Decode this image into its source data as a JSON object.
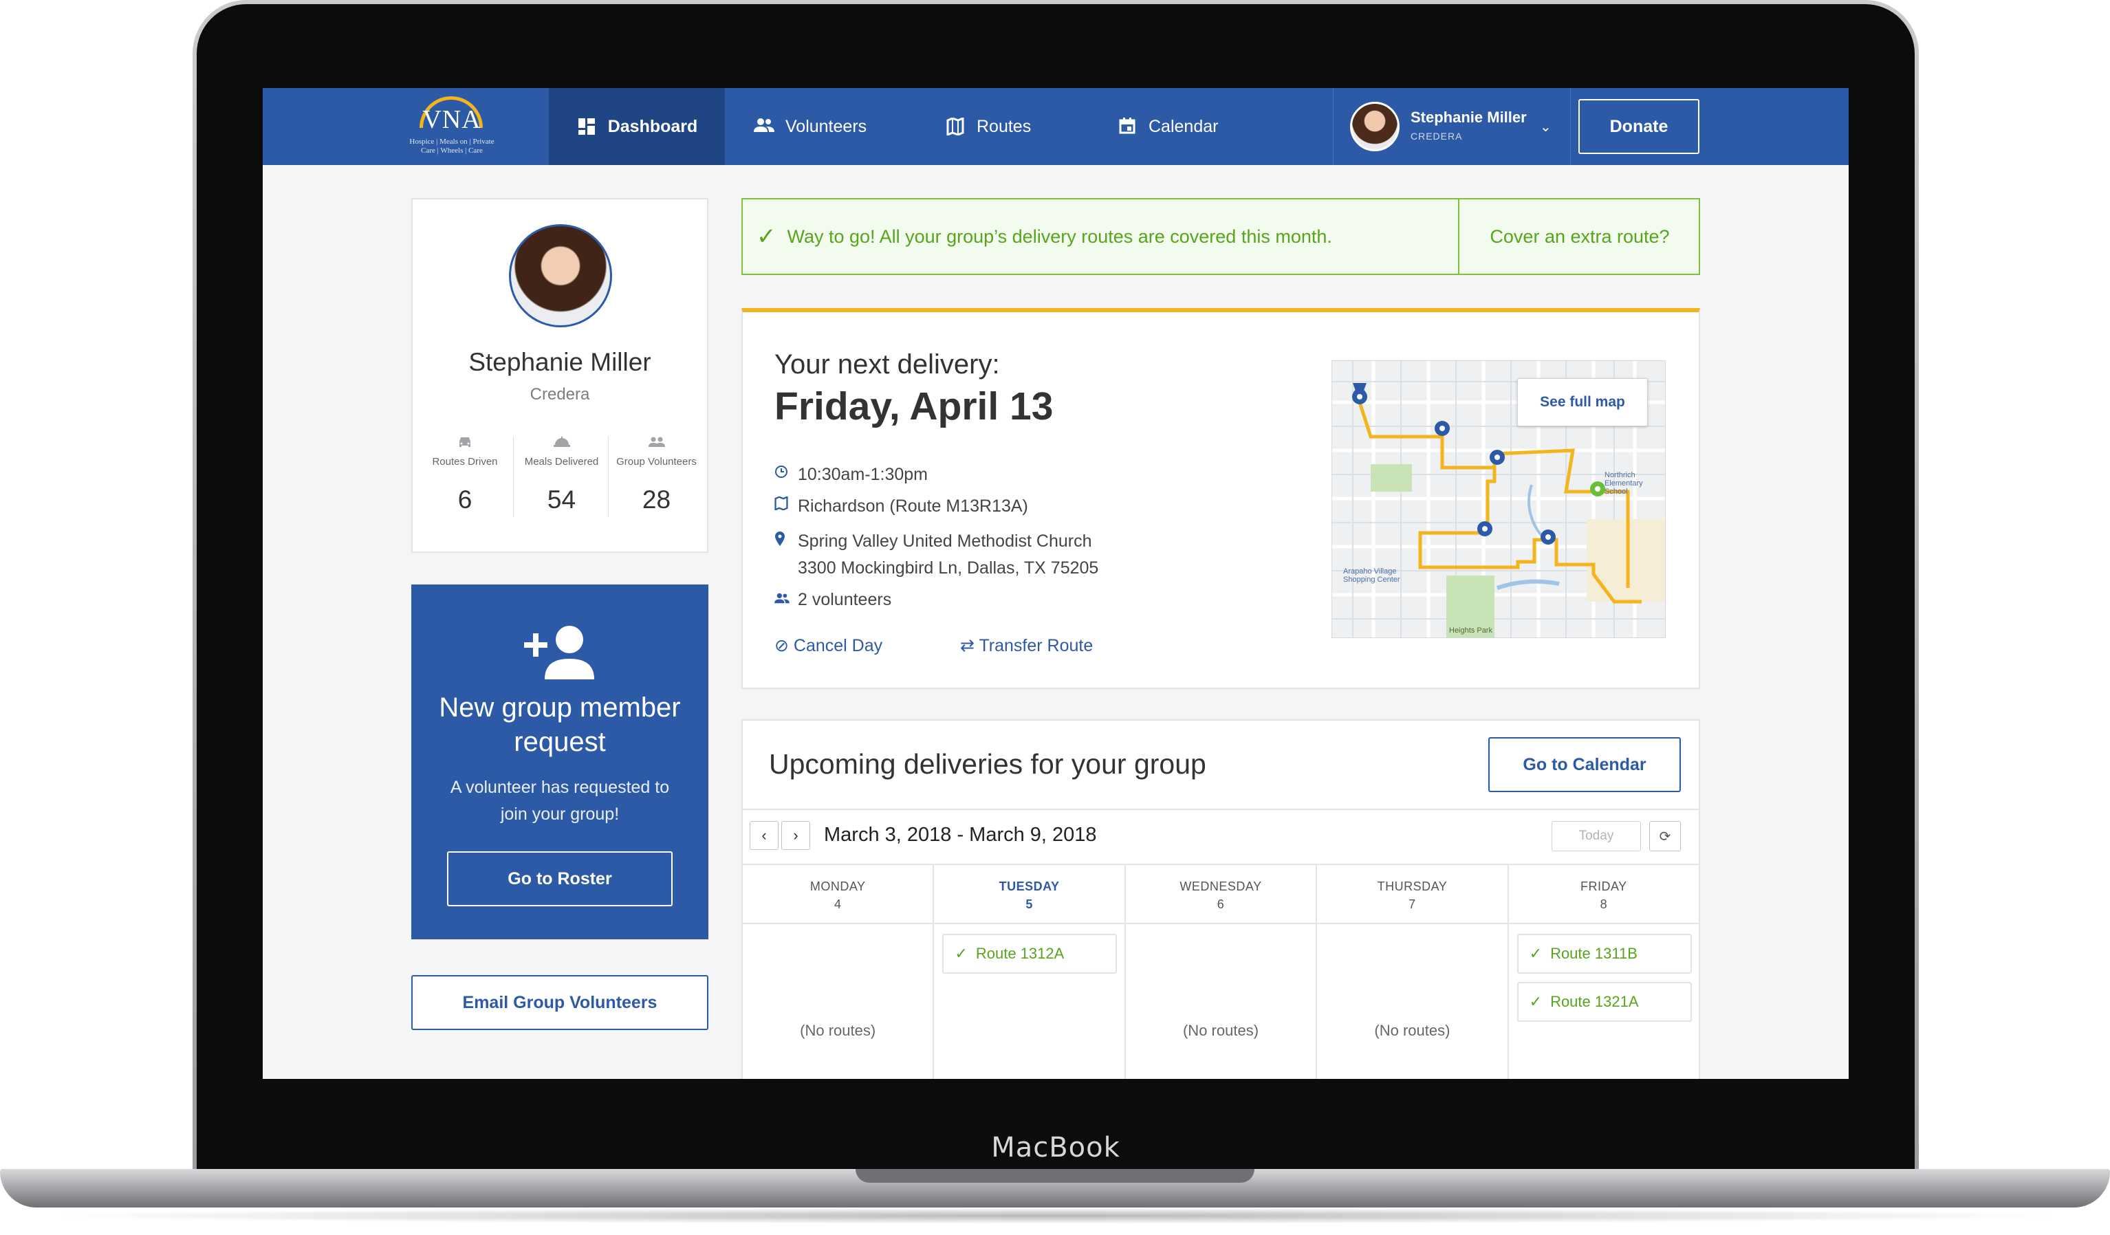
{
  "device": {
    "brand_label": "MacBook"
  },
  "logo": {
    "wordmark": "VNA",
    "tagline": "Hospice | Meals on | Private Care | Wheels | Care"
  },
  "nav": {
    "items": [
      {
        "label": "Dashboard",
        "icon": "dashboard-icon",
        "active": true
      },
      {
        "label": "Volunteers",
        "icon": "people-icon"
      },
      {
        "label": "Routes",
        "icon": "routes-map-icon"
      },
      {
        "label": "Calendar",
        "icon": "calendar-icon"
      }
    ],
    "user": {
      "name": "Stephanie Miller",
      "org": "CREDERA"
    },
    "donate_label": "Donate"
  },
  "profile": {
    "name": "Stephanie Miller",
    "org": "Credera",
    "stats": [
      {
        "label": "Routes Driven",
        "value": "6",
        "icon": "car-icon"
      },
      {
        "label": "Meals Delivered",
        "value": "54",
        "icon": "meal-icon"
      },
      {
        "label": "Group Volunteers",
        "value": "28",
        "icon": "group-icon"
      }
    ]
  },
  "request": {
    "title": "New group member request",
    "description": "A volunteer has requested to join your group!",
    "button_label": "Go to Roster"
  },
  "email_button_label": "Email Group Volunteers",
  "banner": {
    "message": "Way to go! All your group’s delivery routes are covered this month.",
    "cta_label": "Cover an extra route?"
  },
  "delivery": {
    "heading": "Your next delivery:",
    "date": "Friday, April 13",
    "time": "10:30am-1:30pm",
    "route": "Richardson (Route M13R13A)",
    "location_name": "Spring Valley United Methodist Church",
    "location_address": "3300 Mockingbird Ln, Dallas, TX 75205",
    "volunteers": "2 volunteers",
    "cancel_label": "Cancel Day",
    "transfer_label": "Transfer Route",
    "map_button_label": "See full map",
    "map_labels": [
      "Northrich Elementary School",
      "Arapaho Village Shopping Center",
      "Heights Park"
    ]
  },
  "upcoming": {
    "title": "Upcoming deliveries for your group",
    "calendar_button_label": "Go to Calendar",
    "week_range": "March 3, 2018 - March 9, 2018",
    "today_label": "Today",
    "days": [
      {
        "name": "MONDAY",
        "num": "4",
        "active": false,
        "routes": [],
        "empty_label": "(No routes)"
      },
      {
        "name": "TUESDAY",
        "num": "5",
        "active": true,
        "routes": [
          "Route 1312A"
        ],
        "empty_label": ""
      },
      {
        "name": "WEDNESDAY",
        "num": "6",
        "active": false,
        "routes": [],
        "empty_label": "(No routes)"
      },
      {
        "name": "THURSDAY",
        "num": "7",
        "active": false,
        "routes": [],
        "empty_label": "(No routes)"
      },
      {
        "name": "FRIDAY",
        "num": "8",
        "active": false,
        "routes": [
          "Route 1311B",
          "Route 1321A"
        ],
        "empty_label": ""
      }
    ]
  },
  "colors": {
    "primary": "#2d5aa6",
    "primary_dark": "#1f4584",
    "accent_gold": "#f2b51d",
    "success": "#56a51d"
  }
}
